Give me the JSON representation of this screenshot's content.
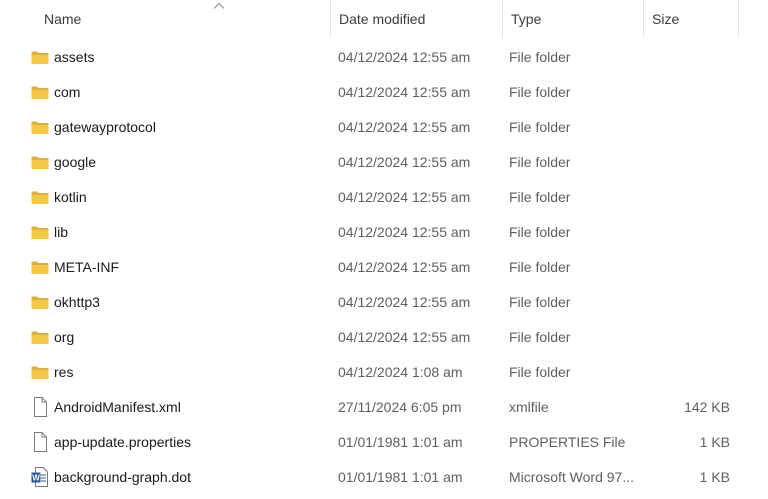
{
  "columns": {
    "name": "Name",
    "date_modified": "Date modified",
    "type": "Type",
    "size": "Size"
  },
  "sort": {
    "column": "name",
    "direction": "ascending"
  },
  "colors": {
    "folder_back": "#dcb13f",
    "folder_front": "#f3c845",
    "word_blue": "#2b5797",
    "file_outline": "#7a7a7a"
  },
  "files": [
    {
      "name": "assets",
      "date": "04/12/2024 12:55 am",
      "type": "File folder",
      "size": "",
      "icon": "folder-icon"
    },
    {
      "name": "com",
      "date": "04/12/2024 12:55 am",
      "type": "File folder",
      "size": "",
      "icon": "folder-icon"
    },
    {
      "name": "gatewayprotocol",
      "date": "04/12/2024 12:55 am",
      "type": "File folder",
      "size": "",
      "icon": "folder-icon"
    },
    {
      "name": "google",
      "date": "04/12/2024 12:55 am",
      "type": "File folder",
      "size": "",
      "icon": "folder-icon"
    },
    {
      "name": "kotlin",
      "date": "04/12/2024 12:55 am",
      "type": "File folder",
      "size": "",
      "icon": "folder-icon"
    },
    {
      "name": "lib",
      "date": "04/12/2024 12:55 am",
      "type": "File folder",
      "size": "",
      "icon": "folder-icon"
    },
    {
      "name": "META-INF",
      "date": "04/12/2024 12:55 am",
      "type": "File folder",
      "size": "",
      "icon": "folder-icon"
    },
    {
      "name": "okhttp3",
      "date": "04/12/2024 12:55 am",
      "type": "File folder",
      "size": "",
      "icon": "folder-icon"
    },
    {
      "name": "org",
      "date": "04/12/2024 12:55 am",
      "type": "File folder",
      "size": "",
      "icon": "folder-icon"
    },
    {
      "name": "res",
      "date": "04/12/2024 1:08 am",
      "type": "File folder",
      "size": "",
      "icon": "folder-icon"
    },
    {
      "name": "AndroidManifest.xml",
      "date": "27/11/2024 6:05 pm",
      "type": "xmlfile",
      "size": "142 KB",
      "icon": "blank-file-icon"
    },
    {
      "name": "app-update.properties",
      "date": "01/01/1981 1:01 am",
      "type": "PROPERTIES File",
      "size": "1 KB",
      "icon": "blank-file-icon"
    },
    {
      "name": "background-graph.dot",
      "date": "01/01/1981 1:01 am",
      "type": "Microsoft Word 97...",
      "size": "1 KB",
      "icon": "word-document-icon"
    }
  ]
}
